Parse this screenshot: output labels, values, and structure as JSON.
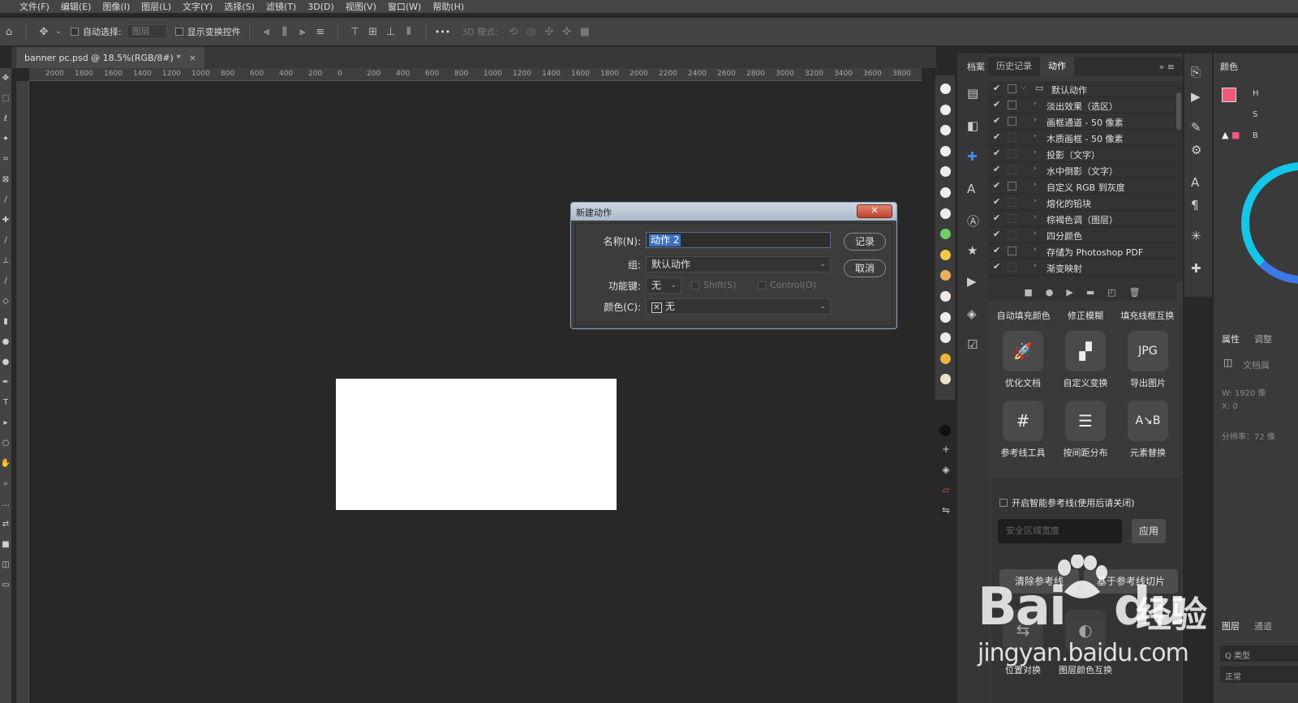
{
  "menu": [
    "文件(F)",
    "编辑(E)",
    "图像(I)",
    "图层(L)",
    "文字(Y)",
    "选择(S)",
    "滤镜(T)",
    "3D(D)",
    "视图(V)",
    "窗口(W)",
    "帮助(H)"
  ],
  "options_bar": {
    "auto_select_label": "自动选择:",
    "layer_select_value": "图层",
    "show_transform_label": "显示变换控件",
    "more": "•••",
    "mode_3d_label": "3D 模式:"
  },
  "document_tab": {
    "title": "banner pc.psd @ 18.5%(RGB/8#) *",
    "close": "×"
  },
  "ruler_ticks": [
    "2000",
    "1800",
    "1600",
    "1400",
    "1200",
    "1000",
    "800",
    "600",
    "400",
    "200",
    "0",
    "200",
    "400",
    "600",
    "800",
    "1000",
    "1200",
    "1400",
    "1600",
    "1800",
    "2000",
    "2200",
    "2400",
    "2600",
    "2800",
    "3000",
    "3200",
    "3400",
    "3600",
    "3800"
  ],
  "dialog": {
    "title": "新建动作",
    "close_glyph": "✕",
    "name_label": "名称(N):",
    "name_value": "动作 2",
    "group_label": "组:",
    "group_value": "默认动作",
    "fkey_label": "功能键:",
    "fkey_value": "无",
    "shift_label": "Shift(S)",
    "control_label": "Control(O)",
    "color_label": "颜色(C):",
    "color_value": "无",
    "record_button": "记录",
    "cancel_button": "取消"
  },
  "swatch_colors": [
    "#f0f0f0",
    "#efefef",
    "#eeeeee",
    "#eeeeee",
    "#ededed",
    "#ededed",
    "#ececec",
    "#6fcf6a",
    "#f2c94c",
    "#e9b15a",
    "#efe9e3",
    "#ececec",
    "#eeeaea",
    "#e9b53c",
    "#eedfc8"
  ],
  "strip_extra": {
    "black_dot": "#111111"
  },
  "panel_tabs": [
    "历史记录",
    "动作"
  ],
  "panel_left_tab": "档案",
  "actions": [
    {
      "label": "默认动作",
      "box": true,
      "expand": "⌵",
      "folder": true
    },
    {
      "label": "淡出效果（选区）",
      "box": true
    },
    {
      "label": "画框通道 - 50 像素",
      "box": true
    },
    {
      "label": "木质画框 - 50 像素",
      "box": false
    },
    {
      "label": "投影（文字）",
      "box": false
    },
    {
      "label": "水中倒影（文字）",
      "box": false
    },
    {
      "label": "自定义 RGB 到灰度",
      "box": true
    },
    {
      "label": "熔化的铅块",
      "box": false
    },
    {
      "label": "棕褐色调（图层）",
      "box": false
    },
    {
      "label": "四分颜色",
      "box": false
    },
    {
      "label": "存储为 Photoshop PDF",
      "box": true
    },
    {
      "label": "渐变映射",
      "box": false
    }
  ],
  "plugin": {
    "header": [
      "自动填充颜色",
      "修正模糊",
      "填充线框互换"
    ],
    "tools": [
      {
        "icon": "🚀",
        "label": "优化文档"
      },
      {
        "icon": "▞",
        "label": "自定义变换"
      },
      {
        "icon": "JPG",
        "label": "导出图片"
      },
      {
        "icon": "#",
        "label": "参考线工具"
      },
      {
        "icon": "☰",
        "label": "按间距分布"
      },
      {
        "icon": "A↘B",
        "label": "元素替换"
      }
    ],
    "smart_guides_label": "开启智能参考线(使用后请关闭)",
    "safe_area_placeholder": "安全区域宽度",
    "apply_button": "应用",
    "clear_guides_button": "清除参考线",
    "slice_button": "基于参考线切片",
    "pos_swap": "位置对换",
    "layer_color_swap": "图层颜色互换"
  },
  "far_right": {
    "color_tab": "颜色",
    "properties_tab": "属性",
    "adjust_tab": "调整",
    "doc_label": "文档属",
    "w_label": "W:  1920 像",
    "x_label": "X:  0",
    "resolution": "分辨率：72 像",
    "layers_tab": "图层",
    "channels_tab": "通道",
    "kind_label": "Q 类型",
    "blend_mode": "正常",
    "slider_labels": [
      "H",
      "S",
      "B"
    ]
  },
  "watermark": {
    "brand": "Bai",
    "du": "du",
    "cn": "经验",
    "url": "jingyan.baidu.com"
  }
}
